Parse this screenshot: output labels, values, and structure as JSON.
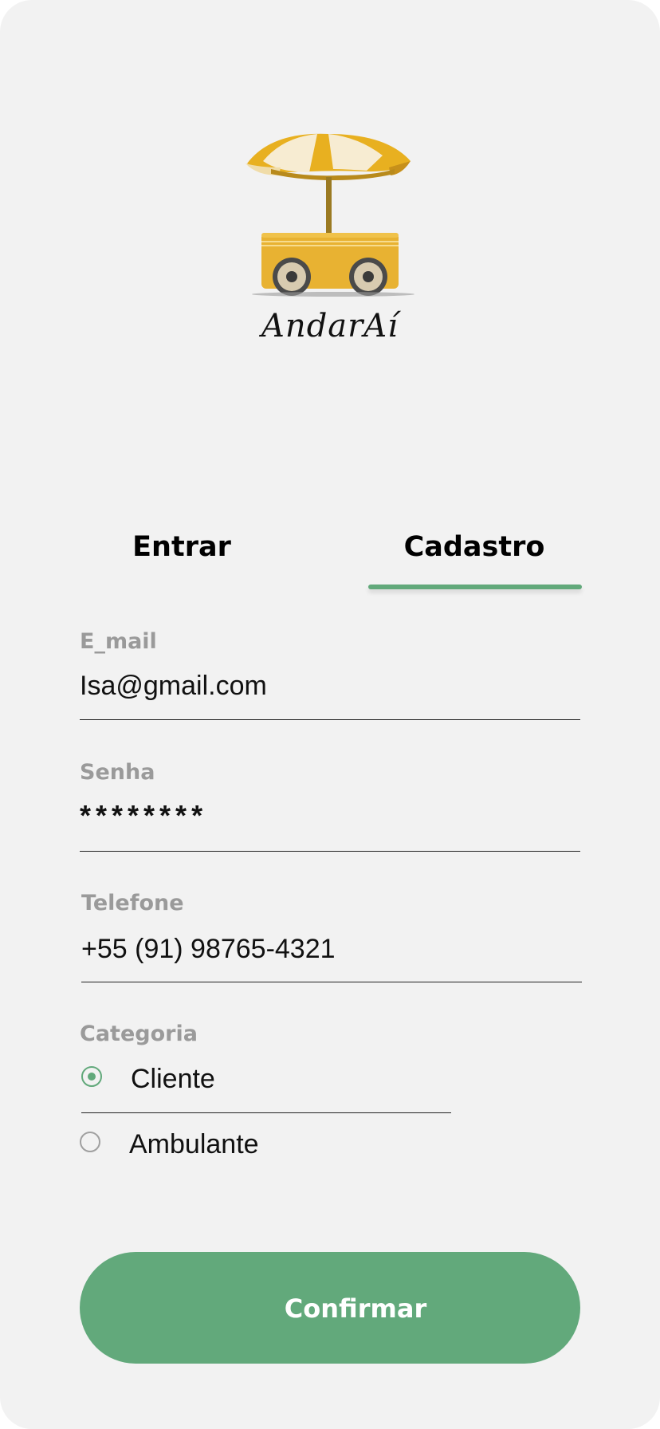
{
  "brand": {
    "name": "AndarAí",
    "logo_icon": "umbrella-cart-icon"
  },
  "tabs": [
    {
      "label": "Entrar",
      "active": false
    },
    {
      "label": "Cadastro",
      "active": true
    }
  ],
  "form": {
    "email": {
      "label": "E_mail",
      "value": "Isa@gmail.com"
    },
    "password": {
      "label": "Senha",
      "value": "********"
    },
    "phone": {
      "label": "Telefone",
      "value": "+55 (91) 98765-4321"
    },
    "category": {
      "label": "Categoria",
      "options": [
        {
          "label": "Cliente",
          "selected": true
        },
        {
          "label": "Ambulante",
          "selected": false
        }
      ]
    }
  },
  "confirm_label": "Confirmar",
  "colors": {
    "accent": "#62a97b",
    "background": "#f2f2f2",
    "label_gray": "#9a9a9a",
    "umbrella_yellow": "#e8b020",
    "umbrella_cream": "#f7ecd2",
    "cart_yellow": "#e8b232"
  }
}
